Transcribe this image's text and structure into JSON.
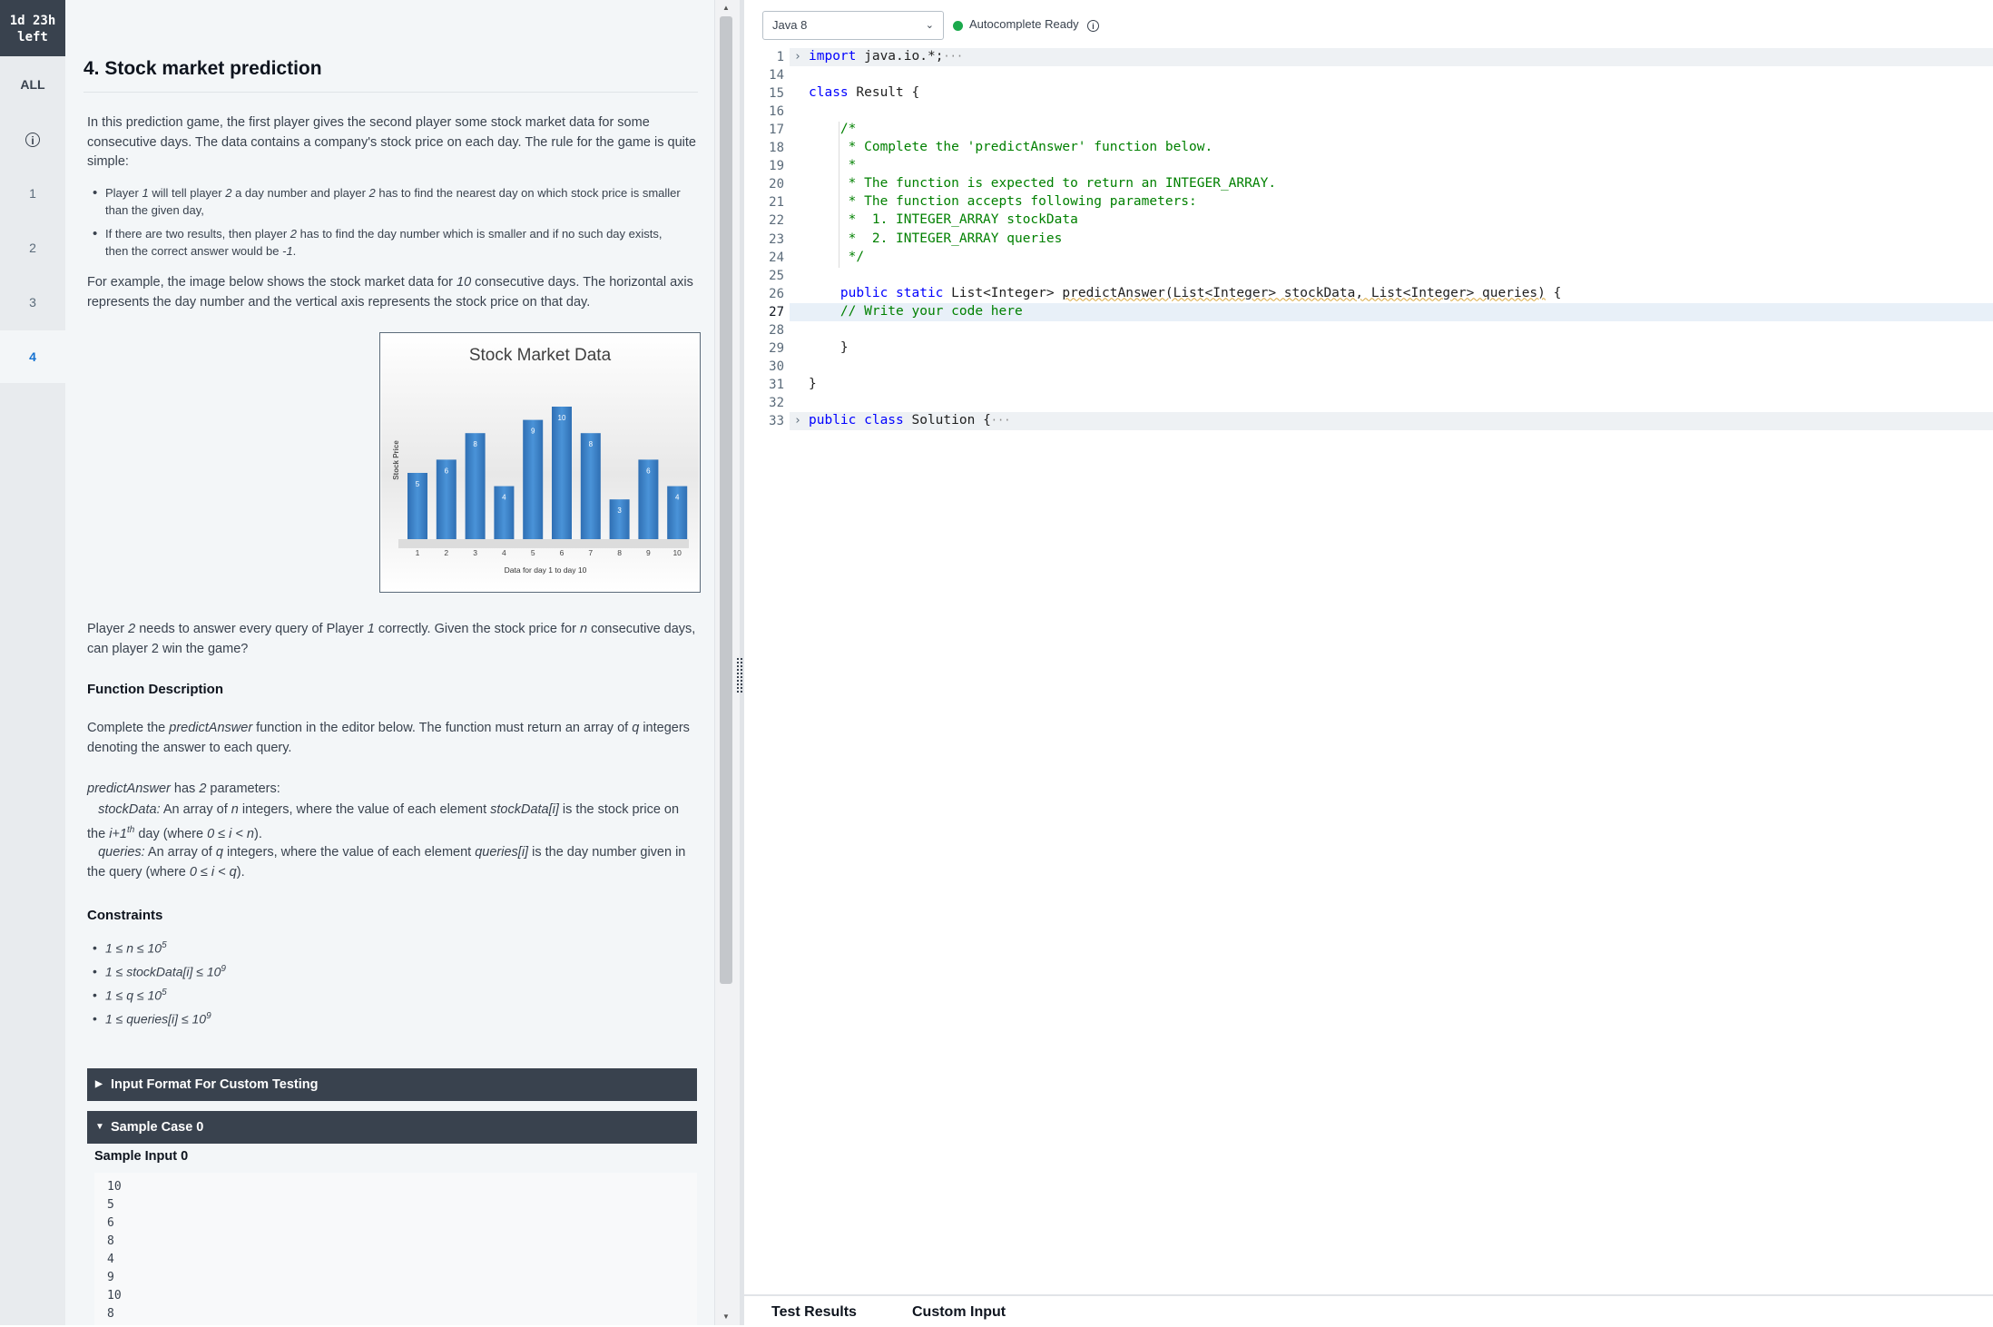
{
  "timer": {
    "line1": "1d 23h",
    "line2": "left"
  },
  "rail": {
    "all": "ALL",
    "items": [
      "1",
      "2",
      "3",
      "4"
    ]
  },
  "problem": {
    "title": "4. Stock market prediction",
    "intro": "In this prediction game, the first player gives the second player some stock market data for some consecutive days. The data contains a company's stock price on each day. The rule for the game is quite simple:",
    "rule1_a": "Player ",
    "rule1_p1": "1",
    "rule1_b": " will tell player ",
    "rule1_p2": "2",
    "rule1_c": " a day number and player ",
    "rule1_p3": "2",
    "rule1_d": " has to find the nearest day on which stock price is smaller than the given day,",
    "rule2_a": "If there are two results, then player ",
    "rule2_p": "2",
    "rule2_b": " has to find the day number which is smaller and if no such day exists, then the correct answer would be ",
    "rule2_val": "-1",
    "rule2_end": ".",
    "example_a": "For example, the image below shows the stock market data for ",
    "example_n": "10",
    "example_b": " consecutive days. The horizontal axis represents the day number and the vertical axis represents the stock price on that day.",
    "question_a": "Player ",
    "question_p2": "2",
    "question_b": " needs to answer every query of Player ",
    "question_p1": "1",
    "question_c": " correctly. Given the stock price for ",
    "question_n": "n",
    "question_d": " consecutive days, can player 2 win the game?",
    "func_heading": "Function Description",
    "func_a": "Complete the ",
    "func_name": "predictAnswer",
    "func_b": " function in the editor below. The function must return an array of ",
    "func_q": "q",
    "func_c": " integers denoting the answer to each query.",
    "params_name": "predictAnswer",
    "params_a": " has ",
    "params_n": "2",
    "params_b": " parameters:",
    "p1_name": "stockData:",
    "p1_a": " An array of ",
    "p1_n": "n",
    "p1_b": " integers, where the value of each element ",
    "p1_el": "stockData[i]",
    "p1_c": " is the stock price on the ",
    "p1_i": "i+1",
    "p1_sup": "th",
    "p1_d": " day (where ",
    "p1_cond": "0 ≤ i < n",
    "p1_e": ").",
    "p2_name": "queries:",
    "p2_a": " An array of ",
    "p2_q": "q",
    "p2_b": " integers, where the value of each element ",
    "p2_el": "queries[i]",
    "p2_c": " is the day number given in the query (where ",
    "p2_cond": "0 ≤ i < q",
    "p2_d": ").",
    "constraints_heading": "Constraints",
    "constraints": [
      {
        "text": "1 ≤ n ≤ 10",
        "sup": "5"
      },
      {
        "text": "1 ≤ stockData[i] ≤ 10",
        "sup": "9"
      },
      {
        "text": "1 ≤ q ≤ 10",
        "sup": "5"
      },
      {
        "text": "1 ≤ queries[i] ≤ 10",
        "sup": "9"
      }
    ],
    "input_format_label": "Input Format For Custom Testing",
    "sample_case_label": "Sample Case 0",
    "sample_input_label": "Sample Input 0",
    "sample_lines": [
      "10",
      "5",
      "6",
      "8",
      "4",
      "9",
      "10",
      "8"
    ]
  },
  "chart_data": {
    "type": "bar",
    "title": "Stock Market Data",
    "xlabel": "Data for day 1 to day 10",
    "ylabel": "Stock Price",
    "categories": [
      "1",
      "2",
      "3",
      "4",
      "5",
      "6",
      "7",
      "8",
      "9",
      "10"
    ],
    "values": [
      5,
      6,
      8,
      4,
      9,
      10,
      8,
      3,
      6,
      4
    ],
    "ylim": [
      0,
      10
    ],
    "bar_color": "#3f83c9"
  },
  "editor": {
    "language": "Java 8",
    "autocomplete": "Autocomplete Ready",
    "lines": [
      {
        "n": "1",
        "fold": true,
        "parts": [
          [
            "kw",
            "import"
          ],
          [
            "",
            " java.io.*;"
          ],
          [
            "ell",
            "···"
          ]
        ]
      },
      {
        "n": "14",
        "parts": []
      },
      {
        "n": "15",
        "parts": [
          [
            "kw",
            "class"
          ],
          [
            "",
            " Result {"
          ]
        ]
      },
      {
        "n": "16",
        "parts": []
      },
      {
        "n": "17",
        "parts": [
          [
            "cm",
            "    /*"
          ]
        ]
      },
      {
        "n": "18",
        "parts": [
          [
            "cm",
            "     * Complete the 'predictAnswer' function below."
          ]
        ]
      },
      {
        "n": "19",
        "parts": [
          [
            "cm",
            "     *"
          ]
        ]
      },
      {
        "n": "20",
        "parts": [
          [
            "cm",
            "     * The function is expected to return an INTEGER_ARRAY."
          ]
        ]
      },
      {
        "n": "21",
        "parts": [
          [
            "cm",
            "     * The function accepts following parameters:"
          ]
        ]
      },
      {
        "n": "22",
        "parts": [
          [
            "cm",
            "     *  1. INTEGER_ARRAY stockData"
          ]
        ]
      },
      {
        "n": "23",
        "parts": [
          [
            "cm",
            "     *  2. INTEGER_ARRAY queries"
          ]
        ]
      },
      {
        "n": "24",
        "parts": [
          [
            "cm",
            "     */"
          ]
        ]
      },
      {
        "n": "25",
        "parts": []
      },
      {
        "n": "26",
        "parts": [
          [
            "",
            "    "
          ],
          [
            "kw",
            "public static"
          ],
          [
            "",
            " List<Integer> "
          ],
          [
            "wavy",
            "predictAnswer(List<Integer> stockData, List<Integer> queries)"
          ],
          [
            "",
            " {"
          ]
        ]
      },
      {
        "n": "27",
        "parts": [
          [
            "cm",
            "    // Write your code here"
          ]
        ]
      },
      {
        "n": "28",
        "parts": []
      },
      {
        "n": "29",
        "parts": [
          [
            "",
            "    }"
          ]
        ]
      },
      {
        "n": "30",
        "parts": []
      },
      {
        "n": "31",
        "parts": [
          [
            "",
            "}"
          ]
        ]
      },
      {
        "n": "32",
        "parts": []
      },
      {
        "n": "33",
        "fold": true,
        "parts": [
          [
            "kw",
            "public class"
          ],
          [
            "",
            " Solution {"
          ],
          [
            "ell",
            "···"
          ]
        ]
      }
    ]
  },
  "bottom_tabs": {
    "test_results": "Test Results",
    "custom_input": "Custom Input"
  }
}
